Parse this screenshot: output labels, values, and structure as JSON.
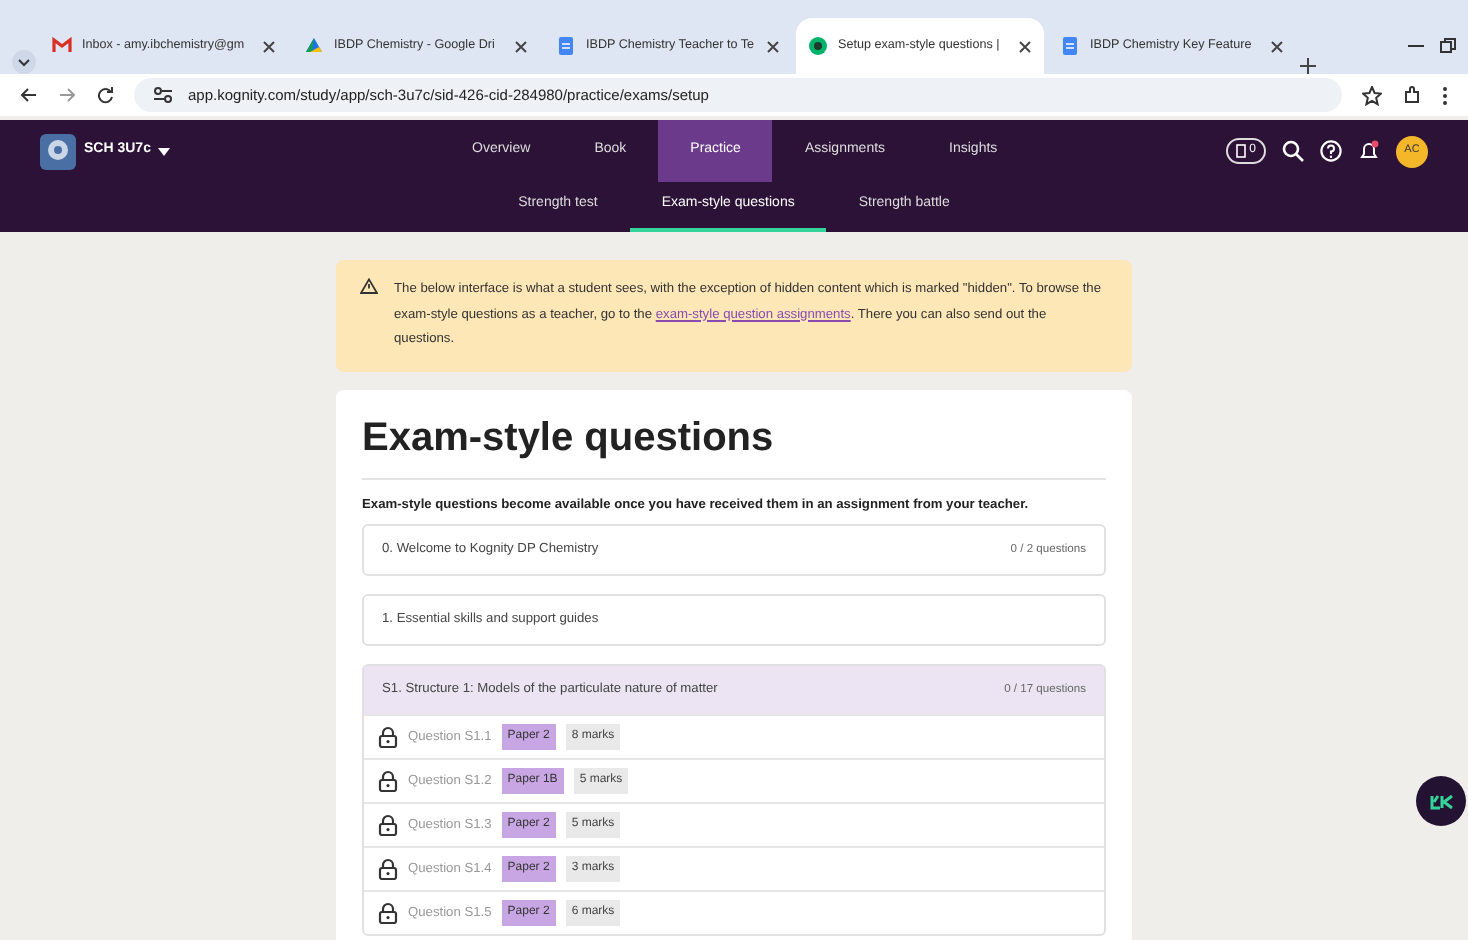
{
  "browser": {
    "tabs": [
      {
        "kind": "mail",
        "label": "Inbox - amy.ibchemistry@gm",
        "selected": false
      },
      {
        "kind": "drive",
        "label": "IBDP Chemistry - Google Dri",
        "selected": false
      },
      {
        "kind": "doc",
        "label": "IBDP Chemistry Teacher to Te",
        "selected": false
      },
      {
        "kind": "app",
        "label": "Setup exam-style questions |",
        "selected": true
      },
      {
        "kind": "doc",
        "label": "IBDP Chemistry Key Feature",
        "selected": false
      }
    ],
    "address": "app.kognity.com/study/app/sch-3u7c/sid-426-cid-284980/practice/exams/setup"
  },
  "app": {
    "course": "SCH 3U7c",
    "nav": [
      {
        "label": "Overview",
        "selected": false
      },
      {
        "label": "Book",
        "selected": false
      },
      {
        "label": "Practice",
        "selected": true
      },
      {
        "label": "Assignments",
        "selected": false
      },
      {
        "label": "Insights",
        "selected": false
      }
    ],
    "subnav": [
      {
        "label": "Strength test",
        "selected": false
      },
      {
        "label": "Exam-style questions",
        "selected": true
      },
      {
        "label": "Strength battle",
        "selected": false
      }
    ],
    "counter": "0",
    "avatar": "AC"
  },
  "notice": {
    "text_before": "The below interface is what a student sees, with the exception of hidden content which is marked \"hidden\". To browse the exam-style questions as a teacher, go to the",
    "link": "exam-style question assignments",
    "text_after": ". There you can also send out the questions."
  },
  "title": "Exam-style questions",
  "intro": "Exam-style questions become available once you have received them in an assignment from your teacher.",
  "sections": [
    {
      "title": "0. Welcome to Kognity DP Chemistry",
      "count": "0 / 2 questions",
      "expanded": false
    },
    {
      "title": "1. Essential skills and support guides",
      "expanded": false
    },
    {
      "title": "S1. Structure 1: Models of the particulate nature of matter",
      "count": "0 / 17 questions",
      "expanded": true,
      "questions": [
        {
          "label": "Question S1.1",
          "paper": "Paper 2",
          "marks": "8 marks"
        },
        {
          "label": "Question S1.2",
          "paper": "Paper 1B",
          "marks": "5 marks"
        },
        {
          "label": "Question S1.3",
          "paper": "Paper 2",
          "marks": "5 marks"
        },
        {
          "label": "Question S1.4",
          "paper": "Paper 2",
          "marks": "3 marks"
        },
        {
          "label": "Question S1.5",
          "paper": "Paper 2",
          "marks": "6 marks"
        }
      ]
    }
  ]
}
